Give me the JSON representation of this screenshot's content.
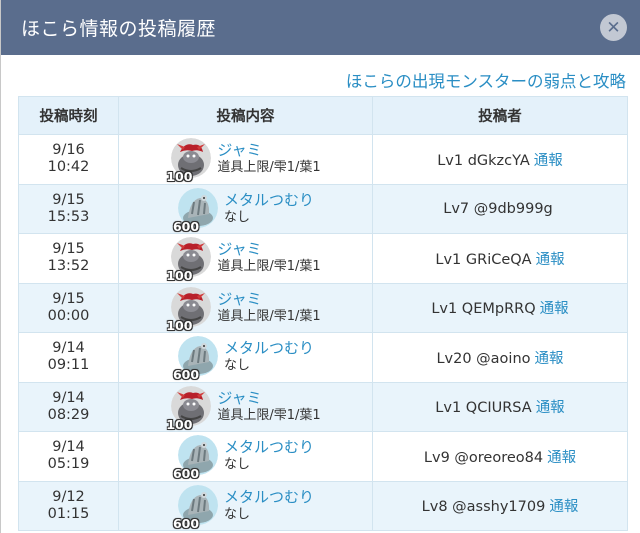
{
  "header": {
    "title": "ほこら情報の投稿履歴",
    "close_label": "✕"
  },
  "top_link": "ほこらの出現モンスターの弱点と攻略",
  "table": {
    "columns": [
      "投稿時刻",
      "投稿内容",
      "投稿者"
    ],
    "rows": [
      {
        "date": "9/16",
        "time": "10:42",
        "monster": "ジャミ",
        "type": "jami",
        "level": "100",
        "desc": "道具上限/雫1/葉1",
        "poster": "Lv1 dGkzcYA",
        "report": "通報"
      },
      {
        "date": "9/15",
        "time": "15:53",
        "monster": "メタルつむり",
        "type": "metal",
        "level": "600",
        "desc": "なし",
        "poster": "Lv7 @9db999g",
        "report": ""
      },
      {
        "date": "9/15",
        "time": "13:52",
        "monster": "ジャミ",
        "type": "jami",
        "level": "100",
        "desc": "道具上限/雫1/葉1",
        "poster": "Lv1 GRiCeQA",
        "report": "通報"
      },
      {
        "date": "9/15",
        "time": "00:00",
        "monster": "ジャミ",
        "type": "jami",
        "level": "100",
        "desc": "道具上限/雫1/葉1",
        "poster": "Lv1 QEMpRRQ",
        "report": "通報"
      },
      {
        "date": "9/14",
        "time": "09:11",
        "monster": "メタルつむり",
        "type": "metal",
        "level": "600",
        "desc": "なし",
        "poster": "Lv20 @aoino",
        "report": "通報"
      },
      {
        "date": "9/14",
        "time": "08:29",
        "monster": "ジャミ",
        "type": "jami",
        "level": "100",
        "desc": "道具上限/雫1/葉1",
        "poster": "Lv1 QCIURSA",
        "report": "通報"
      },
      {
        "date": "9/14",
        "time": "05:19",
        "monster": "メタルつむり",
        "type": "metal",
        "level": "600",
        "desc": "なし",
        "poster": "Lv9 @oreoreo84",
        "report": "通報"
      },
      {
        "date": "9/12",
        "time": "01:15",
        "monster": "メタルつむり",
        "type": "metal",
        "level": "600",
        "desc": "なし",
        "poster": "Lv8 @asshy1709",
        "report": "通報"
      }
    ]
  },
  "colors": {
    "header_bg": "#5a6d8d",
    "link": "#2a8ec4",
    "row_alt": "#e9f4fb",
    "th_bg": "#e4f1fa"
  }
}
